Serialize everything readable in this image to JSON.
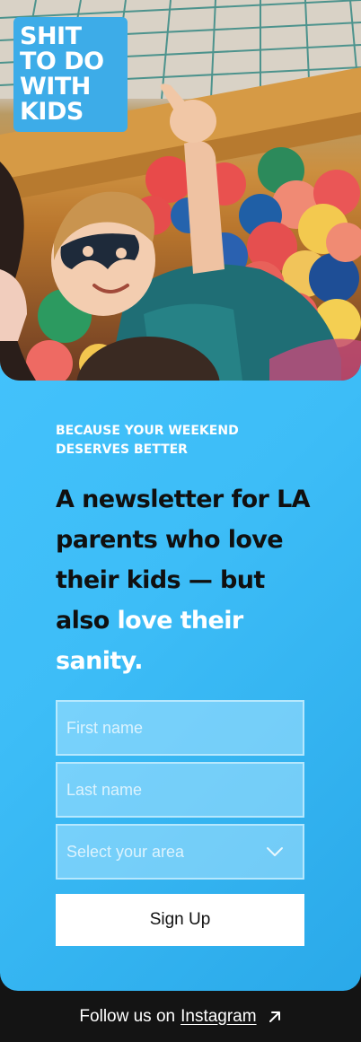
{
  "logo": {
    "lines": [
      "SHIT",
      "TO DO",
      "WITH",
      "KIDS"
    ]
  },
  "hero": {
    "image": "kid-in-ball-pit-photo"
  },
  "hero_text": {
    "eyebrow": "BECAUSE YOUR WEEKEND DESERVES BETTER",
    "headline_dark": "A newsletter for LA parents who love their kids — but also ",
    "headline_highlight": "love their sanity."
  },
  "form": {
    "first_name_placeholder": "First name",
    "last_name_placeholder": "Last name",
    "area_placeholder": "Select your area",
    "submit_label": "Sign Up"
  },
  "footer": {
    "prefix": "Follow us on",
    "link_label": "Instagram",
    "link_icon": "arrow-up-right-icon"
  },
  "colors": {
    "card_bg": "#48c6ff",
    "logo_bg": "#3dace8",
    "footer_bg": "#141414",
    "headline_dark": "#101010",
    "highlight": "#ffffff"
  }
}
